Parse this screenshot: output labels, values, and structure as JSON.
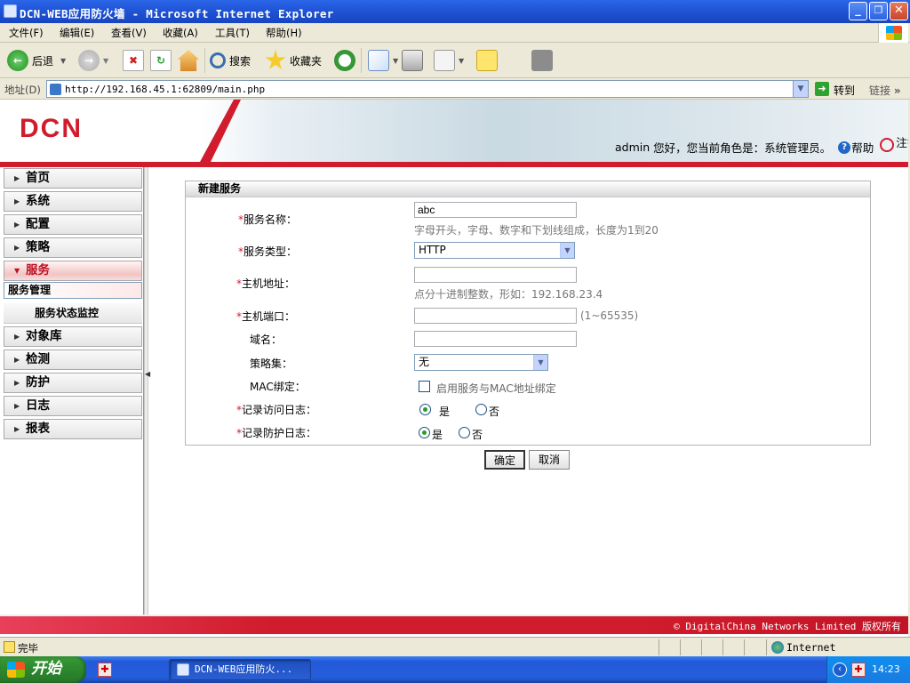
{
  "window": {
    "title": "DCN-WEB应用防火墙 - Microsoft Internet Explorer",
    "controls": {
      "minimize": "_",
      "maximize": "❐",
      "close": "✕"
    }
  },
  "menubar": [
    "文件(F)",
    "编辑(E)",
    "查看(V)",
    "收藏(A)",
    "工具(T)",
    "帮助(H)"
  ],
  "toolbar": {
    "back": "后退",
    "search": "搜索",
    "favorites": "收藏夹"
  },
  "address": {
    "label": "地址(D)",
    "url": "http://192.168.45.1:62809/main.php",
    "go": "转到",
    "links": "链接"
  },
  "header": {
    "logo": "DCN",
    "user": "admin",
    "greeting": "您好，您当前角色是：系统管理员。",
    "help": "帮助",
    "logout": "注销"
  },
  "sidebar": {
    "items": [
      {
        "label": "首页"
      },
      {
        "label": "系统"
      },
      {
        "label": "配置"
      },
      {
        "label": "策略"
      },
      {
        "label": "服务"
      },
      {
        "label": "对象库"
      },
      {
        "label": "检测"
      },
      {
        "label": "防护"
      },
      {
        "label": "日志"
      },
      {
        "label": "报表"
      }
    ],
    "subitems": [
      {
        "label": "服务管理"
      },
      {
        "label": "服务状态监控"
      }
    ]
  },
  "form": {
    "title": "新建服务",
    "service_name": {
      "label": "服务名称：",
      "value": "abc",
      "hint": "字母开头，字母、数字和下划线组成，长度为1到20"
    },
    "service_type": {
      "label": "服务类型：",
      "value": "HTTP"
    },
    "host_addr": {
      "label": "主机地址：",
      "value": "",
      "hint": "点分十进制整数，形如：192.168.23.4"
    },
    "host_port": {
      "label": "主机端口：",
      "value": "",
      "hint": "(1~65535)"
    },
    "domain": {
      "label": "域名：",
      "value": ""
    },
    "policy_set": {
      "label": "策略集：",
      "value": "无"
    },
    "mac_bind": {
      "label": "MAC绑定：",
      "option": "启用服务与MAC地址绑定"
    },
    "access_log": {
      "label": "记录访问日志：",
      "yes": "是",
      "no": "否",
      "selected": "yes"
    },
    "protect_log": {
      "label": "记录防护日志：",
      "yes": "是",
      "no": "否",
      "selected": "yes"
    },
    "required_mark": "*",
    "ok": "确定",
    "cancel": "取消"
  },
  "footer": {
    "copyright": "© DigitalChina Networks Limited 版权所有"
  },
  "status": {
    "text": "完毕",
    "zone": "Internet"
  },
  "taskbar": {
    "start": "开始",
    "task": "DCN-WEB应用防火...",
    "clock": "14:23"
  }
}
